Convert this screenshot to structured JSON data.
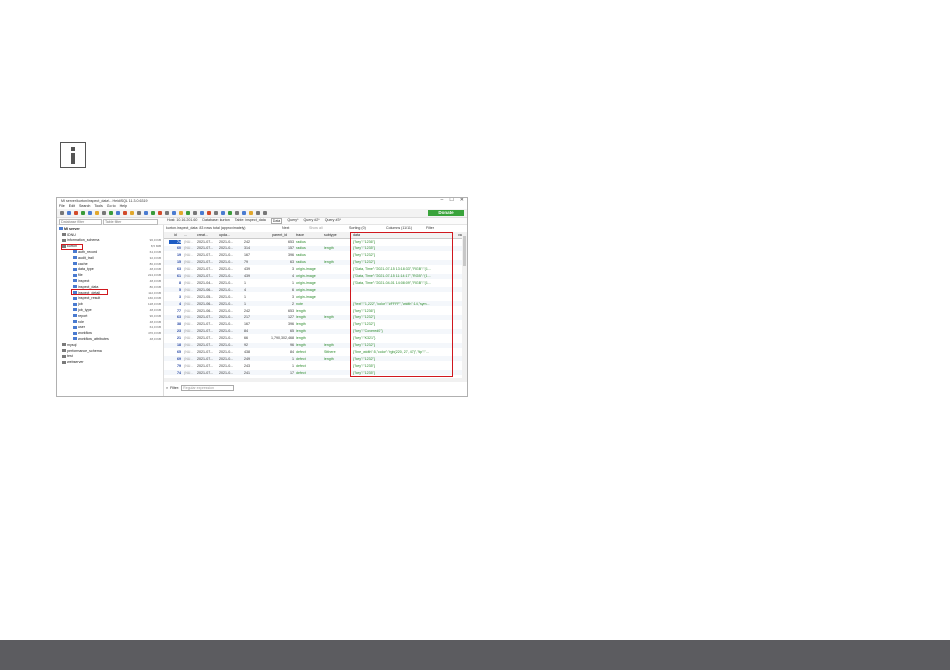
{
  "window": {
    "title": "MI server\\kurton\\inspect_data\\ - HeidiSQL 11.3.0.6319",
    "controls": [
      "–",
      "☐",
      "✕"
    ],
    "menu": [
      "File",
      "Edit",
      "Search",
      "Tools",
      "Go to",
      "Help"
    ],
    "donate_label": "Donate"
  },
  "filters": {
    "database_filter": "Database filter",
    "table_filter": "Table filter"
  },
  "tabs": [
    "Host: 10.16.201.60",
    "Database: kurton",
    "Table: inspect_data",
    "Data",
    "Query*",
    "Query #2*",
    "Query #3*"
  ],
  "tree": {
    "root": "MI server",
    "items": [
      {
        "label": "IDNU",
        "level": 1,
        "size": ""
      },
      {
        "label": "information_schema",
        "level": 1,
        "size": "96,0 KiB"
      },
      {
        "label": "kurton",
        "level": 1,
        "size": "8,5 MiB"
      },
      {
        "label": "auth_record",
        "level": 2,
        "size": "64,0 KiB"
      },
      {
        "label": "audit_trail",
        "level": 2,
        "size": "32,0 KiB"
      },
      {
        "label": "cache",
        "level": 2,
        "size": "80,0 KiB"
      },
      {
        "label": "data_type",
        "level": 2,
        "size": "48,0 KiB"
      },
      {
        "label": "file",
        "level": 2,
        "size": "224,0 KiB"
      },
      {
        "label": "inspect",
        "level": 2,
        "size": "48,0 KiB"
      },
      {
        "label": "inspect_data",
        "level": 2,
        "size": "80,0 KiB"
      },
      {
        "label": "inspect_detail",
        "level": 2,
        "size": "112,0 KiB"
      },
      {
        "label": "inspect_result",
        "level": 2,
        "size": "160,0 KiB"
      },
      {
        "label": "job",
        "level": 2,
        "size": "128,0 KiB"
      },
      {
        "label": "job_type",
        "level": 2,
        "size": "48,0 KiB"
      },
      {
        "label": "report",
        "level": 2,
        "size": "96,0 KiB"
      },
      {
        "label": "role",
        "level": 2,
        "size": "48,0 KiB"
      },
      {
        "label": "user",
        "level": 2,
        "size": "64,0 KiB"
      },
      {
        "label": "workflow",
        "level": 2,
        "size": "476,0 KiB"
      },
      {
        "label": "workflow_attributes",
        "level": 2,
        "size": "48,0 KiB"
      },
      {
        "label": "mysql",
        "level": 1,
        "size": ""
      },
      {
        "label": "performance_schema",
        "level": 1,
        "size": ""
      },
      {
        "label": "test",
        "level": 1,
        "size": ""
      },
      {
        "label": "webserver",
        "level": 1,
        "size": ""
      }
    ]
  },
  "grid": {
    "caption": "kurton.inspect_data: 83 rows total (approximately)",
    "next_label": "Next",
    "show_all_label": "Show all",
    "sorting_label": "Sorting (0)",
    "columns_label": "Columns (11/11)",
    "filter_label": "Filter",
    "headers": [
      "id",
      "...",
      "creat...",
      "upda...",
      "",
      "parent_id",
      "trace",
      "subtype",
      "data",
      "valu"
    ],
    "rows": [
      {
        "id": "74",
        "c1": "(NU...",
        "c2": "2021-07...",
        "c3": "2021-0...",
        "c4": "242",
        "c5": "653",
        "c6": "radius",
        "c7": "",
        "c8": "{\"key\":\"1236\"}"
      },
      {
        "id": "60",
        "c1": "(NU...",
        "c2": "2021-07...",
        "c3": "2021-0...",
        "c4": "314",
        "c5": "157",
        "c6": "radius",
        "c7": "length",
        "c8": "{\"key\":\"1235\"}"
      },
      {
        "id": "19",
        "c1": "(NU...",
        "c2": "2021-07...",
        "c3": "2021-0...",
        "c4": "167",
        "c5": "396",
        "c6": "radius",
        "c7": "",
        "c8": "{\"key\":\"1232\"}"
      },
      {
        "id": "15",
        "c1": "(NU...",
        "c2": "2021-07...",
        "c3": "2021-0...",
        "c4": "79",
        "c5": "63",
        "c6": "radius",
        "c7": "length",
        "c8": "{\"key\":\"1232\"}"
      },
      {
        "id": "63",
        "c1": "(NU...",
        "c2": "2021-07...",
        "c3": "2021-0...",
        "c4": "439",
        "c5": "3",
        "c6": "origin-image",
        "c7": "",
        "c8": "{\"Data, Time\":\"2021-07-15 13:18:33\",\"RGB\":\"(1..."
      },
      {
        "id": "61",
        "c1": "(NU...",
        "c2": "2021-07...",
        "c3": "2021-0...",
        "c4": "439",
        "c5": "4",
        "c6": "origin-image",
        "c7": "",
        "c8": "{\"Data, Time\":\"2021-07-15 11:14:17\",\"RGB\":\"(1..."
      },
      {
        "id": "8",
        "c1": "(NU...",
        "c2": "2021-04...",
        "c3": "2021-0...",
        "c4": "1",
        "c5": "1",
        "c6": "origin-image",
        "c7": "",
        "c8": "{\"Data, Time\":\"2021-04-01 14:08:09\",\"RGB\":\"(1..."
      },
      {
        "id": "5",
        "c1": "(NU...",
        "c2": "2021-06...",
        "c3": "2021-0...",
        "c4": "4",
        "c5": "6",
        "c6": "origin-image",
        "c7": "",
        "c8": ""
      },
      {
        "id": "3",
        "c1": "(NU...",
        "c2": "2021-05...",
        "c3": "2021-0...",
        "c4": "1",
        "c5": "3",
        "c6": "origin-image",
        "c7": "",
        "c8": ""
      },
      {
        "id": "4",
        "c1": "(NU...",
        "c2": "2021-06...",
        "c3": "2021-0...",
        "c4": "1",
        "c5": "2",
        "c6": "note",
        "c7": "",
        "c8": "{\"text\":\"1,222\",\"color\":\"#FFFF\",\"width\":14,\"sym..."
      },
      {
        "id": "77",
        "c1": "(NU...",
        "c2": "2021-06...",
        "c3": "2021-0...",
        "c4": "242",
        "c5": "653",
        "c6": "length",
        "c7": "",
        "c8": "{\"key\":\"1236\"}"
      },
      {
        "id": "63",
        "c1": "(NU...",
        "c2": "2021-07...",
        "c3": "2021-0...",
        "c4": "217",
        "c5": "127",
        "c6": "length",
        "c7": "length",
        "c8": "{\"key\":\"1232\"}"
      },
      {
        "id": "38",
        "c1": "(NU...",
        "c2": "2021-07...",
        "c3": "2021-0...",
        "c4": "167",
        "c5": "396",
        "c6": "length",
        "c7": "",
        "c8": "{\"key\":\"1232\"}"
      },
      {
        "id": "23",
        "c1": "(NU...",
        "c2": "2021-07...",
        "c3": "2021-0...",
        "c4": "84",
        "c5": "65",
        "c6": "length",
        "c7": "",
        "c8": "{\"key\":\"Covered0\"}"
      },
      {
        "id": "21",
        "c1": "(NU...",
        "c2": "2021-07...",
        "c3": "2021-0...",
        "c4": "66",
        "c5": "1,790,302,468",
        "c6": "length",
        "c7": "",
        "c8": "{\"key\":\"K321\"}"
      },
      {
        "id": "18",
        "c1": "(NU...",
        "c2": "2021-07...",
        "c3": "2021-0...",
        "c4": "92",
        "c5": "96",
        "c6": "length",
        "c7": "length",
        "c8": "{\"key\":\"1232\"}"
      },
      {
        "id": "65",
        "c1": "(NU...",
        "c2": "2021-07...",
        "c3": "2021-0...",
        "c4": "438",
        "c5": "84",
        "c6": "defect",
        "c7": "Stthere",
        "c8": "{\"line_width\":5,\"color\":\"rgb(220, 27, 47)\",\"tip\":\"..."
      },
      {
        "id": "69",
        "c1": "(NU...",
        "c2": "2021-07...",
        "c3": "2021-0...",
        "c4": "249",
        "c5": "1",
        "c6": "defect",
        "c7": "length",
        "c8": "{\"key\":\"1232\"}"
      },
      {
        "id": "79",
        "c1": "(NU...",
        "c2": "2021-07...",
        "c3": "2021-0...",
        "c4": "243",
        "c5": "1",
        "c6": "defect",
        "c7": "",
        "c8": "{\"key\":\"1235\"}"
      },
      {
        "id": "74",
        "c1": "(NU...",
        "c2": "2021-07...",
        "c3": "2021-0...",
        "c4": "241",
        "c5": "17",
        "c6": "defect",
        "c7": "",
        "c8": "{\"key\":\"1235\"}"
      }
    ]
  },
  "bottom": {
    "filter_label": "Filter:",
    "filter_placeholder": "Regular expression"
  },
  "colors": {
    "highlight": "#d0181e",
    "donate": "#39a33b",
    "footer": "#5c5c60"
  }
}
